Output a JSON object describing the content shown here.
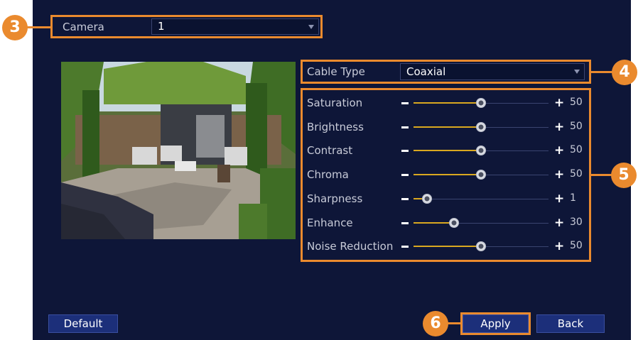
{
  "camera": {
    "label": "Camera",
    "value": "1"
  },
  "cable": {
    "label": "Cable Type",
    "value": "Coaxial"
  },
  "sliders": [
    {
      "name": "Saturation",
      "value": 50,
      "level": 0.5
    },
    {
      "name": "Brightness",
      "value": 50,
      "level": 0.5
    },
    {
      "name": "Contrast",
      "value": 50,
      "level": 0.5
    },
    {
      "name": "Chroma",
      "value": 50,
      "level": 0.5
    },
    {
      "name": "Sharpness",
      "value": 1,
      "level": 0.1
    },
    {
      "name": "Enhance",
      "value": 30,
      "level": 0.3
    },
    {
      "name": "Noise Reduction",
      "value": 50,
      "level": 0.5
    }
  ],
  "buttons": {
    "default": "Default",
    "apply": "Apply",
    "back": "Back"
  },
  "callouts": {
    "c3": "3",
    "c4": "4",
    "c5": "5",
    "c6": "6"
  },
  "slider_symbols": {
    "plus": "+"
  },
  "colors": {
    "panel": "#0e1638",
    "accent": "#ea8a2e",
    "slider_fill": "#d9a820",
    "button": "#1c2f7a"
  }
}
